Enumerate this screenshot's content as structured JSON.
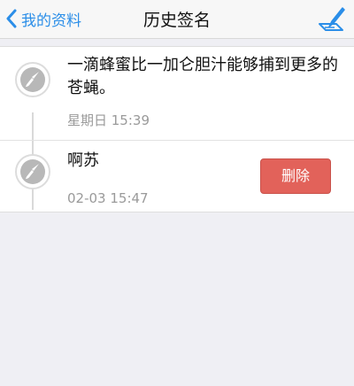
{
  "navbar": {
    "back_label": "我的资料",
    "title": "历史签名",
    "edit_icon": "pen-paper-icon"
  },
  "colors": {
    "accent": "#2b8ee8",
    "delete": "#e2625a",
    "timestamp": "#9a9a9a"
  },
  "signatures": [
    {
      "text": "一滴蜂蜜比一加仑胆汁能够捕到更多的苍蝇。",
      "time": "星期日 15:39",
      "icon": "brush-icon"
    },
    {
      "text": "啊苏",
      "time": "02-03 15:47",
      "icon": "brush-icon",
      "action_label": "删除"
    }
  ]
}
